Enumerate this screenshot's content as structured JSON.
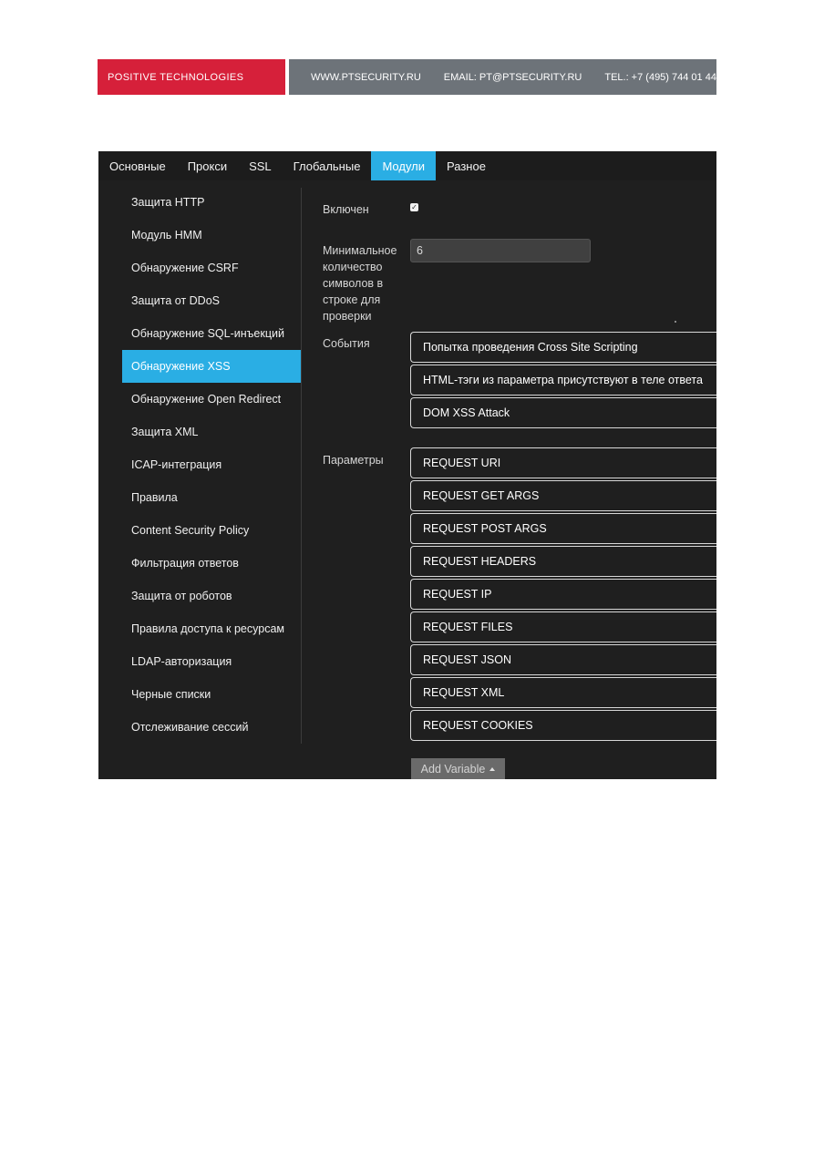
{
  "letterhead": {
    "brand": "POSITIVE TECHNOLOGIES",
    "website": "WWW.PTSECURITY.RU",
    "email": "EMAIL: PT@PTSECURITY.RU",
    "phone": "TEL.: +7 (495) 744 01 44"
  },
  "tabs": [
    {
      "label": "Основные"
    },
    {
      "label": "Прокси"
    },
    {
      "label": "SSL"
    },
    {
      "label": "Глобальные"
    },
    {
      "label": "Модули",
      "active": true
    },
    {
      "label": "Разное"
    }
  ],
  "sidebar": {
    "items": [
      {
        "label": "Защита HTTP"
      },
      {
        "label": "Модуль HMM"
      },
      {
        "label": "Обнаружение CSRF"
      },
      {
        "label": "Защита от DDoS"
      },
      {
        "label": "Обнаружение SQL-инъекций"
      },
      {
        "label": "Обнаружение XSS",
        "active": true
      },
      {
        "label": "Обнаружение Open Redirect"
      },
      {
        "label": "Защита XML"
      },
      {
        "label": "ICAP-интеграция"
      },
      {
        "label": "Правила"
      },
      {
        "label": "Content Security Policy"
      },
      {
        "label": "Фильтрация ответов"
      },
      {
        "label": "Защита от роботов"
      },
      {
        "label": "Правила доступа к ресурсам"
      },
      {
        "label": "LDAP-авторизация"
      },
      {
        "label": "Черные списки"
      },
      {
        "label": "Отслеживание сессий"
      }
    ]
  },
  "form": {
    "enabled_label": "Включен",
    "enabled_checked": true,
    "min_chars_label_lines": [
      "Минимальное",
      "количество",
      "символов в",
      "строке для",
      "проверки"
    ],
    "min_chars_value": "6",
    "events_label": "События",
    "events": [
      {
        "label": "Попытка проведения Cross Site Scripting"
      },
      {
        "label": "HTML-тэги из параметра присутствуют в теле ответа"
      },
      {
        "label": "DOM XSS Attack"
      }
    ],
    "params_label": "Параметры",
    "params": [
      {
        "label": "REQUEST URI"
      },
      {
        "label": "REQUEST GET ARGS"
      },
      {
        "label": "REQUEST POST ARGS"
      },
      {
        "label": "REQUEST HEADERS"
      },
      {
        "label": "REQUEST IP"
      },
      {
        "label": "REQUEST FILES"
      },
      {
        "label": "REQUEST JSON"
      },
      {
        "label": "REQUEST XML"
      },
      {
        "label": "REQUEST COOKIES"
      }
    ],
    "add_variable_label": "Add Variable"
  },
  "icons": {
    "checkbox": "check-icon",
    "add_variable_caret": "caret-up-icon"
  },
  "colors": {
    "brand_red": "#d6203a",
    "letterhead_gray": "#6d7379",
    "accent_blue": "#2aaee4",
    "panel_bg": "#1f1f1f"
  }
}
